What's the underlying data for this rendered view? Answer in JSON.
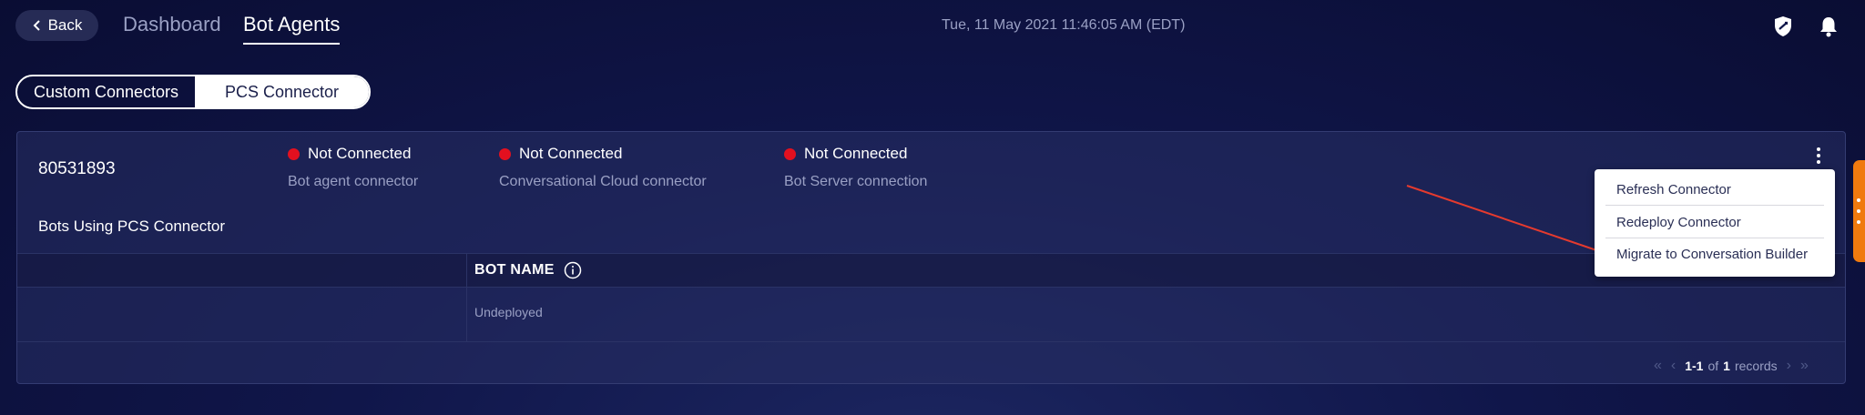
{
  "header": {
    "back_label": "Back",
    "nav_dashboard": "Dashboard",
    "nav_bot_agents": "Bot Agents",
    "datetime": "Tue, 11 May 2021 11:46:05 AM (EDT)"
  },
  "toggle": {
    "custom": "Custom Connectors",
    "pcs": "PCS Connector",
    "selected": "PCS Connector"
  },
  "agent": {
    "id": "80531893",
    "statuses": [
      {
        "state": "Not Connected",
        "label": "Bot agent connector"
      },
      {
        "state": "Not Connected",
        "label": "Conversational Cloud connector"
      },
      {
        "state": "Not Connected",
        "label": "Bot Server connection"
      }
    ],
    "bots_heading": "Bots Using PCS Connector"
  },
  "table": {
    "column": "BOT NAME",
    "rows": [
      {
        "status": "Undeployed"
      }
    ]
  },
  "pager": {
    "range": "1-1",
    "of": "of",
    "total": "1",
    "suffix": "records"
  },
  "menu": {
    "items": [
      "Refresh Connector",
      "Redeploy Connector",
      "Migrate to Conversation Builder"
    ]
  },
  "colors": {
    "status_dot": "#e3101f",
    "accent": "#f07a0e",
    "annotation_arrow": "#e53a2e"
  }
}
